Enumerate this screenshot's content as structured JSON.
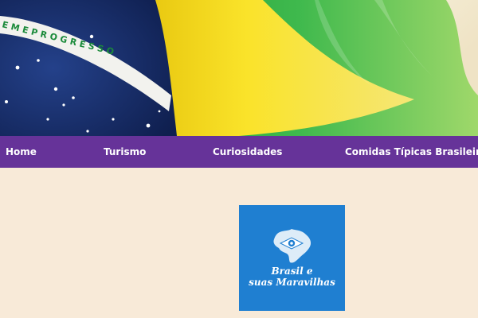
{
  "banner": {
    "flag_motto": "ORDEM E PROGRESSO",
    "colors": {
      "green": "#1faa3a",
      "yellow": "#f7e11c",
      "blue": "#1b2f6e",
      "white_band": "#f2f2ee"
    }
  },
  "nav": {
    "items": [
      {
        "label": "Home"
      },
      {
        "label": "Turismo"
      },
      {
        "label": "Curiosidades"
      },
      {
        "label": "Comidas Típicas Brasileira"
      }
    ],
    "background": "#663399"
  },
  "logo": {
    "line1": "Brasil e",
    "line2": "suas Maravilhas",
    "background": "#1f7fd1",
    "icon": "brazil-map-with-eye-icon"
  },
  "page": {
    "background": "#f8ead8"
  }
}
